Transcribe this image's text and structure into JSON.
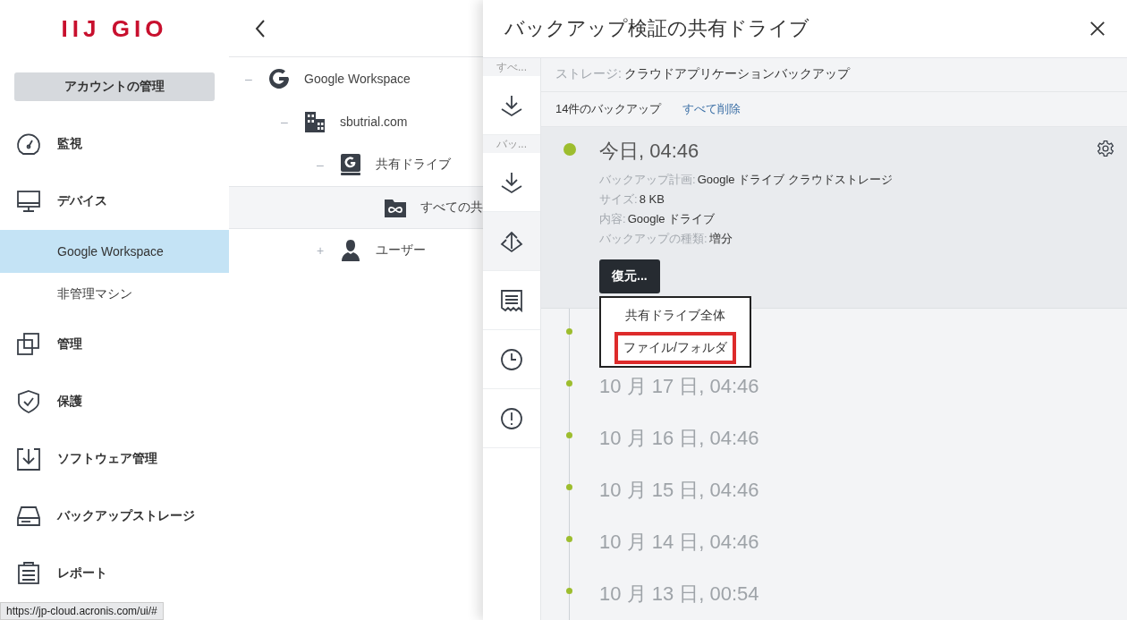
{
  "logo": "IIJ GIO",
  "account_button": "アカウントの管理",
  "nav": [
    {
      "label": "監視",
      "kind": "gauge",
      "selected": false
    },
    {
      "label": "デバイス",
      "kind": "monitor",
      "selected": false
    },
    {
      "label": "Google Workspace",
      "kind": "sub",
      "selected": true
    },
    {
      "label": "非管理マシン",
      "kind": "sub",
      "selected": false
    },
    {
      "label": "管理",
      "kind": "squares",
      "selected": false
    },
    {
      "label": "保護",
      "kind": "shield",
      "selected": false
    },
    {
      "label": "ソフトウェア管理",
      "kind": "tray",
      "selected": false
    },
    {
      "label": "バックアップストレージ",
      "kind": "drive",
      "selected": false
    },
    {
      "label": "レポート",
      "kind": "report",
      "selected": false
    }
  ],
  "tree": [
    {
      "label": "Google Workspace",
      "toggle": "–",
      "kind": "google",
      "selected": false,
      "children": [
        {
          "label": "sbutrial.com",
          "toggle": "–",
          "kind": "building",
          "selected": false,
          "children": [
            {
              "label": "共有ドライブ",
              "toggle": "–",
              "kind": "drive",
              "selected": false,
              "children": [
                {
                  "label": "すべての共",
                  "kind": "folder",
                  "selected": true
                }
              ]
            },
            {
              "label": "ユーザー",
              "toggle": "+",
              "kind": "user",
              "selected": false
            }
          ]
        }
      ]
    }
  ],
  "panel": {
    "title": "バックアップ検証の共有ドライブ",
    "strip": [
      {
        "kind": "label",
        "label": "すべ..."
      },
      {
        "kind": "download",
        "selected": false
      },
      {
        "kind": "label",
        "label": "バッ..."
      },
      {
        "kind": "download",
        "selected": false
      },
      {
        "kind": "upload",
        "selected": true
      },
      {
        "kind": "list",
        "selected": false
      },
      {
        "kind": "clock",
        "selected": false
      },
      {
        "kind": "alert",
        "selected": false
      }
    ],
    "storage": {
      "label": "ストレージ:",
      "value": "クラウドアプリケーションバックアップ"
    },
    "count": "14件のバックアップ",
    "delete_all": "すべて削除",
    "backups": [
      {
        "date": "今日, 04:46",
        "expanded": true,
        "details": [
          {
            "label": "バックアップ計画:",
            "value": "Google ドライブ クラウドストレージ"
          },
          {
            "label": "サイズ:",
            "value": "8 KB"
          },
          {
            "label": "内容:",
            "value": "Google ドライブ"
          },
          {
            "label": "バックアップの種類:",
            "value": "増分"
          }
        ],
        "restore_button": "復元...",
        "menu": [
          {
            "label": "共有ドライブ全体",
            "highlighted": false
          },
          {
            "label": "ファイル/フォルダ",
            "highlighted": true
          }
        ]
      },
      {
        "expanded": false
      },
      {
        "date": "10 月 17 日, 04:46",
        "expanded": false
      },
      {
        "date": "10 月 16 日, 04:46",
        "expanded": false
      },
      {
        "date": "10 月 15 日, 04:46",
        "expanded": false
      },
      {
        "date": "10 月 14 日, 04:46",
        "expanded": false
      },
      {
        "date": "10 月 13 日, 00:54",
        "expanded": false
      }
    ]
  },
  "status_url": "https://jp-cloud.acronis.com/ui/#"
}
